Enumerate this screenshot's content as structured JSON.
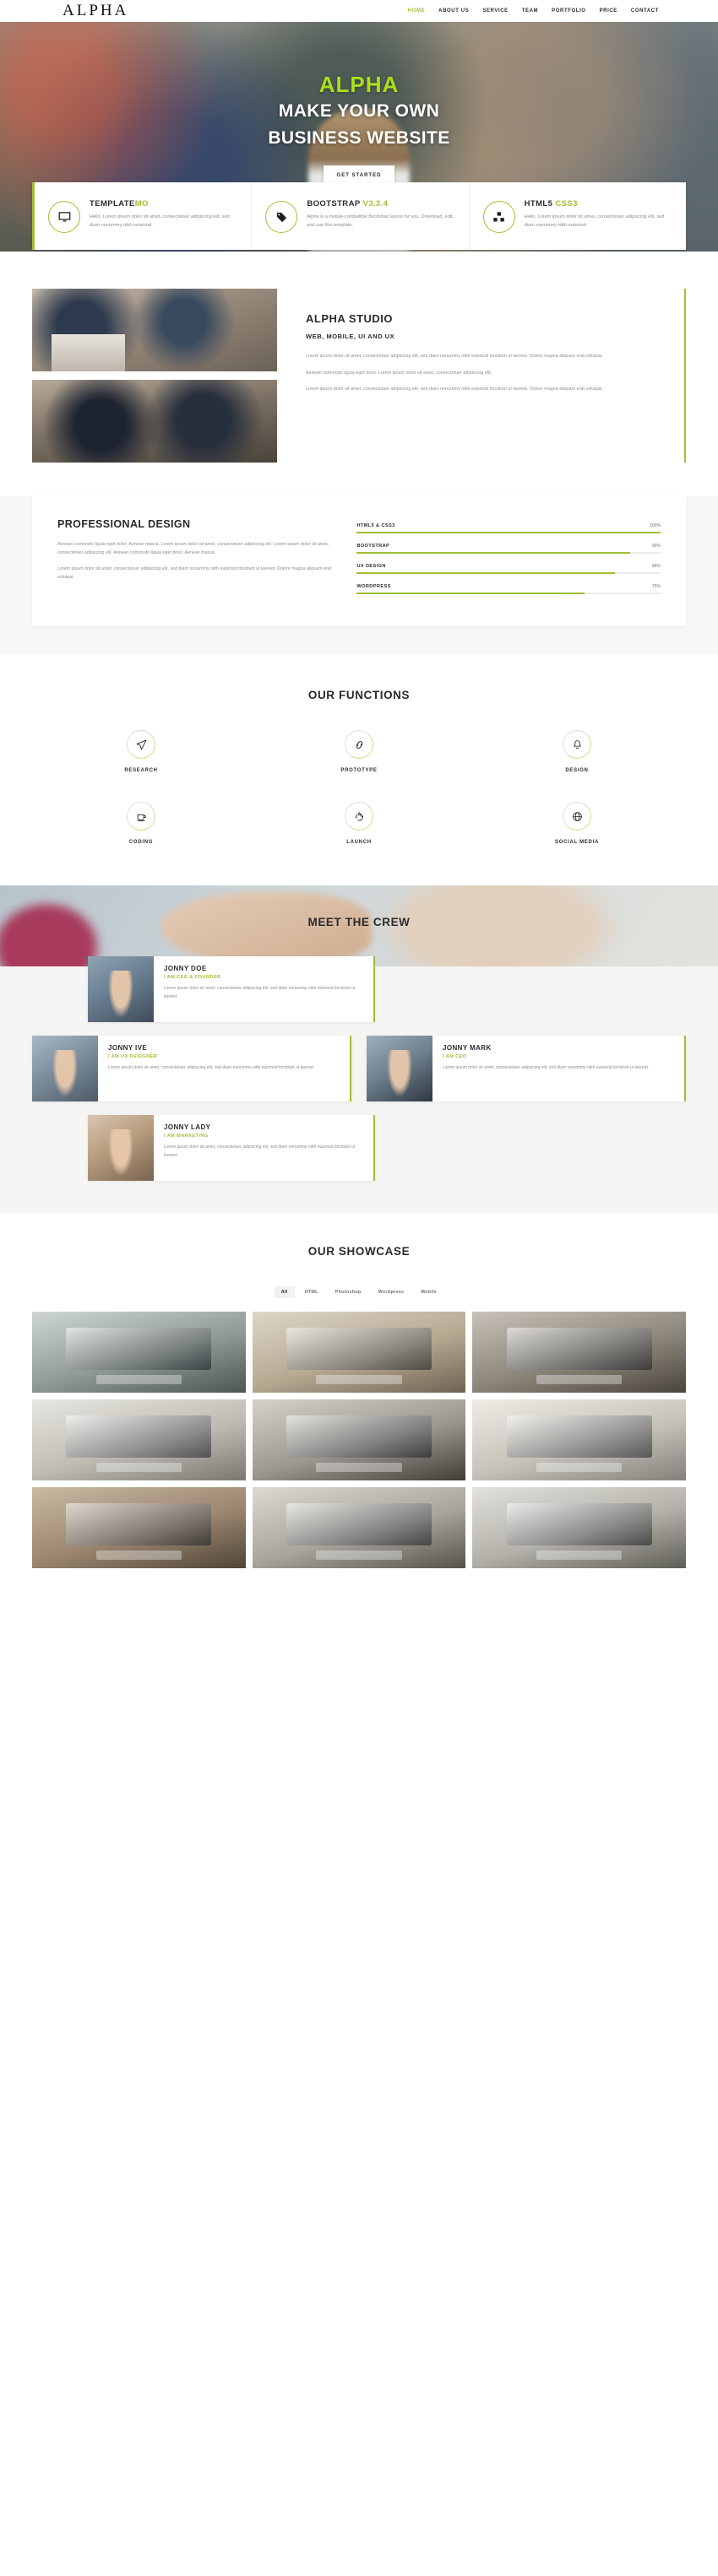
{
  "header": {
    "brand": "ALPHA",
    "nav": [
      {
        "label": "HOME",
        "active": true
      },
      {
        "label": "ABOUT US",
        "active": false
      },
      {
        "label": "SERVICE",
        "active": false
      },
      {
        "label": "TEAM",
        "active": false
      },
      {
        "label": "PORTFOLIO",
        "active": false
      },
      {
        "label": "PRICE",
        "active": false
      },
      {
        "label": "CONTACT",
        "active": false
      }
    ]
  },
  "hero": {
    "title": "ALPHA",
    "line1": "MAKE YOUR OWN",
    "line2": "BUSINESS WEBSITE",
    "button": "GET STARTED",
    "accent_color": "#a8e01a"
  },
  "features": [
    {
      "icon": "monitor-icon",
      "title": "TEMPLATE",
      "title_highlight": "MO",
      "text": "Hello. Lorem ipsum dolor sit amet, consectetuer adipiscing elit, sed diam nonummy nibh euismod."
    },
    {
      "icon": "tags-icon",
      "title": "BOOTSTRAP",
      "title_highlight": "V3.3.4",
      "text": "Alpha is a mobile-compatible Bootstrap layout for you. Download, edit, and use this template."
    },
    {
      "icon": "cubes-icon",
      "title": "HTML5",
      "title_highlight": "CSS3",
      "text": "Hello. Lorem ipsum dolor sit amet, consectetuer adipiscing elit, sed diam nonummy nibh euismod."
    }
  ],
  "studio": {
    "heading": "ALPHA STUDIO",
    "subheading": "WEB, MOBILE, UI AND UX",
    "p1": "Lorem ipsum dolor sit amet, consectetuer adipiscing elit, sed diam nonummy nibh euismod tincidunt ut laoreet. Dolore magna aliquam erat volutpat.",
    "p2": "Aenean commodo ligula eget dolor. Lorem ipsum dolor sit amet, consectetuer adipiscing elit.",
    "p3": "Lorem ipsum dolor sit amet, consectetuer adipiscing elit, sed diam nonummy nibh euismod tincidunt ut laoreet. Dolore magna aliquam erat volutpat."
  },
  "professional": {
    "heading": "PROFESSIONAL DESIGN",
    "p1": "Aenean commodo ligula eget dolor. Aenean massa. Lorem ipsum dolor sit amet, consectetuer adipiscing elit. Lorem ipsum dolor sit amet, consectetuer adipiscing elit. Aenean commodo ligula eget dolor, Aenean massa.",
    "p2": "Lorem ipsum dolor sit amet, consectetuer adipiscing elit, sed diam nonummy nibh euismod tincidunt ut laoreet. Dolore magna aliquam erat volutpat."
  },
  "chart_data": {
    "type": "bar",
    "title": "PROFESSIONAL DESIGN",
    "categories": [
      "HTML5 & CSS3",
      "BOOTSTRAP",
      "UX DESIGN",
      "WORDPRESS"
    ],
    "values": [
      100,
      90,
      85,
      75
    ],
    "labels": [
      "100%",
      "90%",
      "85%",
      "75%"
    ],
    "xlabel": "",
    "ylabel": "",
    "ylim": [
      0,
      100
    ],
    "orientation": "horizontal",
    "bar_color": "#9fc131",
    "track_color": "#ececec",
    "grid": false,
    "legend": false
  },
  "functions": {
    "heading": "OUR FUNCTIONS",
    "items": [
      {
        "icon": "paper-plane-icon",
        "label": "RESEARCH"
      },
      {
        "icon": "link-icon",
        "label": "PROTOTYPE"
      },
      {
        "icon": "bell-icon",
        "label": "DESIGN"
      },
      {
        "icon": "coffee-icon",
        "label": "CODING"
      },
      {
        "icon": "recycle-icon",
        "label": "LAUNCH"
      },
      {
        "icon": "globe-icon",
        "label": "SOCIAL MEDIA"
      }
    ]
  },
  "team": {
    "heading": "MEET THE CREW",
    "members": [
      {
        "name": "JONNY DOE",
        "role": "I AM CEO & FOUNDER",
        "text": "Lorem ipsum dolor sit amet, consectetuer adipiscing elit, sed diam nonummy nibh euismod tincidunt ut laoreet."
      },
      {
        "name": "JONNY IVE",
        "role": "I AM UX DESIGNER",
        "text": "Lorem ipsum dolor sit amet, consectetuer adipiscing elit, sed diam nonummy nibh euismod tincidunt ut laoreet."
      },
      {
        "name": "JONNY MARK",
        "role": "I AM CEO",
        "text": "Lorem ipsum dolor sit amet, consectetuer adipiscing elit, sed diam nonummy nibh euismod tincidunt ut laoreet."
      },
      {
        "name": "JONNY LADY",
        "role": "I AM MARKETING",
        "text": "Lorem ipsum dolor sit amet, consectetuer adipiscing elit, sed diam nonummy nibh euismod tincidunt ut laoreet."
      }
    ]
  },
  "showcase": {
    "heading": "OUR SHOWCASE",
    "filters": [
      {
        "label": "All",
        "active": true
      },
      {
        "label": "HTML",
        "active": false
      },
      {
        "label": "Photoshop",
        "active": false
      },
      {
        "label": "Wordpress",
        "active": false
      },
      {
        "label": "Mobile",
        "active": false
      }
    ]
  }
}
